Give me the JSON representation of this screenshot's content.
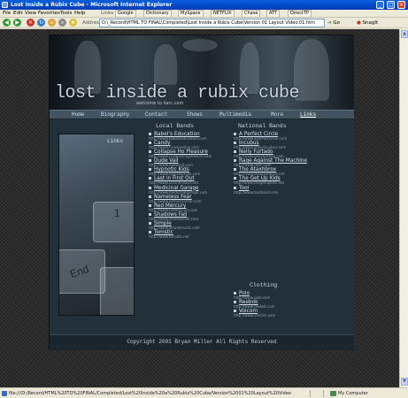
{
  "window": {
    "title": "Lost Inside a Rubix Cube - Microsoft Internet Explorer",
    "controls": [
      "_",
      "□",
      "×"
    ]
  },
  "menubar": {
    "items": [
      "File",
      "Edit",
      "View",
      "Favorites",
      "Tools",
      "Help"
    ],
    "links_label": "Links",
    "links": [
      "Google",
      "Dictionary",
      "MySpace",
      "NETFLIX",
      "Chase",
      "ATT",
      "DirectTP"
    ]
  },
  "toolbar": {
    "address_label": "Address",
    "address_value": "D:\\_Record\\HTML TO FINAL\\Completed\\Lost Inside a Rubix Cube\\Version 01 Layout Video.01.htm",
    "go_label": "Go",
    "snagit_label": "SnagIt"
  },
  "site": {
    "title": "lost inside a rubix cube",
    "tagline": "welcome to liarc.com",
    "nav": [
      "Home",
      "Biography",
      "Contact",
      "Shows",
      "Multimedia",
      "More",
      "Links"
    ],
    "photo_label": "Links",
    "local_heading": "Local Bands",
    "national_heading": "National Bands",
    "clothing_heading": "Clothing",
    "local_bands": [
      {
        "name": "Babel's Education",
        "url": "http://www.babelseducation.com"
      },
      {
        "name": "Candy",
        "url": "http://www.candyonline.com"
      },
      {
        "name": "Collapse Ho Pleasure",
        "url": "http://www.collapsehopleasure.com"
      },
      {
        "name": "Dude Vail",
        "url": "http://www.dudevail.com"
      },
      {
        "name": "Hypnotic Kids",
        "url": "http://www.hypnotickids.com"
      },
      {
        "name": "Last in First Out",
        "url": "http://www.lastinfirstout.net"
      },
      {
        "name": "Medicinal Garage",
        "url": "http://www.medicinalgarage.com"
      },
      {
        "name": "Nameless Fear",
        "url": "http://www.namelessfear.com"
      },
      {
        "name": "Red Mercury",
        "url": "http://www.redmercury.com"
      },
      {
        "name": "Shadows Fall",
        "url": "http://www.shadowsfall.com"
      },
      {
        "name": "Simple",
        "url": "http://www.simplemusic.com"
      },
      {
        "name": "Tomstic",
        "url": "http://www.tomstic.net"
      }
    ],
    "national_bands": [
      {
        "name": "A Perfect Circle",
        "url": "http://www.aperfectcircle.com"
      },
      {
        "name": "Incubus",
        "url": "http://www.enjoyincubus.com"
      },
      {
        "name": "Nelly Furtado",
        "url": "http://www.nellyfurtado.com"
      },
      {
        "name": "Rage Against The Machine",
        "url": "http://www.ratm.com"
      },
      {
        "name": "The Ataxhbrox",
        "url": "http://www.theataxhbrox.net"
      },
      {
        "name": "The Get Up Kids",
        "url": "http://www.thegetupkids.net"
      },
      {
        "name": "Tool",
        "url": "http://www.toolband.com"
      }
    ],
    "clothing": [
      {
        "name": "Polo",
        "url": "http://www.polo.com"
      },
      {
        "name": "Reebok",
        "url": "http://www.reebok.com"
      },
      {
        "name": "Volcom",
        "url": "http://www.volcom.com"
      }
    ],
    "footer": "Copyright 2001 Bryan Miller All Rights Reserved"
  },
  "statusbar": {
    "text": "file:///D:/Record/HTML%20TO%20FINAL/Completed/Lost%20Inside%20a%20Rubix%20Cube/Version%2001%20Layout%20Video",
    "zone": "My Computer"
  }
}
